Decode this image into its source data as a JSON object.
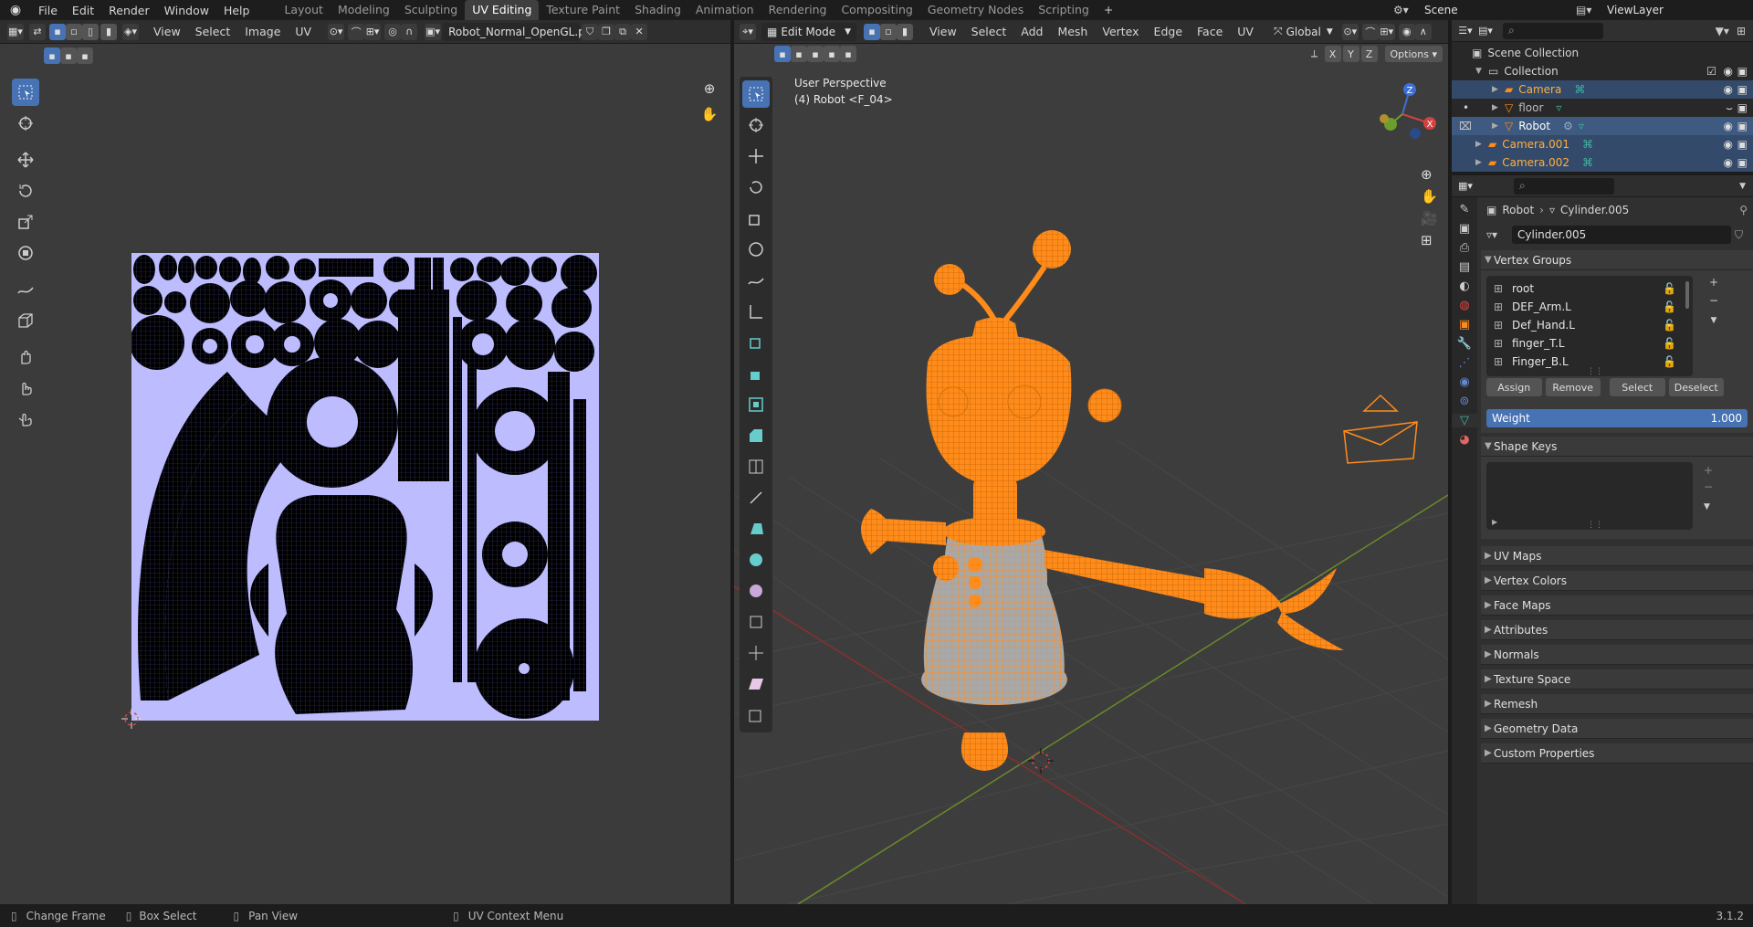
{
  "topbar": {
    "menu": [
      "File",
      "Edit",
      "Render",
      "Window",
      "Help"
    ],
    "workspaces": [
      "Layout",
      "Modeling",
      "Sculpting",
      "UV Editing",
      "Texture Paint",
      "Shading",
      "Animation",
      "Rendering",
      "Compositing",
      "Geometry Nodes",
      "Scripting"
    ],
    "active_workspace": "UV Editing",
    "scene": "Scene",
    "view_layer": "ViewLayer"
  },
  "uv_editor": {
    "menus": [
      "View",
      "Select",
      "Image",
      "UV"
    ],
    "image_name": "Robot_Normal_OpenGL.png",
    "texture_bg": "#bcbcff"
  },
  "viewport": {
    "mode": "Edit Mode",
    "menus": [
      "View",
      "Select",
      "Add",
      "Mesh",
      "Vertex",
      "Edge",
      "Face",
      "UV"
    ],
    "orientation": "Global",
    "axes": [
      "X",
      "Y",
      "Z"
    ],
    "options_label": "Options",
    "overlay_line1": "User Perspective",
    "overlay_line2": "(4) Robot <F_04>",
    "gizmo": {
      "x": "X",
      "y": "Y",
      "z": "Z"
    },
    "accent": "#ff8c1a"
  },
  "outliner": {
    "root": "Scene Collection",
    "collection": "Collection",
    "items": [
      {
        "label": "Camera",
        "selected": true
      },
      {
        "label": "floor",
        "selected": false
      },
      {
        "label": "Robot",
        "selected": true
      },
      {
        "label": "Camera.001",
        "selected": true
      },
      {
        "label": "Camera.002",
        "selected": true
      }
    ]
  },
  "properties": {
    "breadcrumb_object": "Robot",
    "breadcrumb_mesh": "Cylinder.005",
    "mesh_name": "Cylinder.005",
    "vertex_groups_title": "Vertex Groups",
    "vertex_groups": [
      "root",
      "DEF_Arm.L",
      "Def_Hand.L",
      "finger_T.L",
      "Finger_B.L"
    ],
    "buttons": {
      "assign": "Assign",
      "remove": "Remove",
      "select": "Select",
      "deselect": "Deselect"
    },
    "weight_label": "Weight",
    "weight_value": "1.000",
    "shape_keys_title": "Shape Keys",
    "collapsed_sections": [
      "UV Maps",
      "Vertex Colors",
      "Face Maps",
      "Attributes",
      "Normals",
      "Texture Space",
      "Remesh",
      "Geometry Data",
      "Custom Properties"
    ]
  },
  "statusbar": {
    "change_frame": "Change Frame",
    "box_select": "Box Select",
    "pan_view": "Pan View",
    "context_menu": "UV Context Menu",
    "version": "3.1.2"
  }
}
